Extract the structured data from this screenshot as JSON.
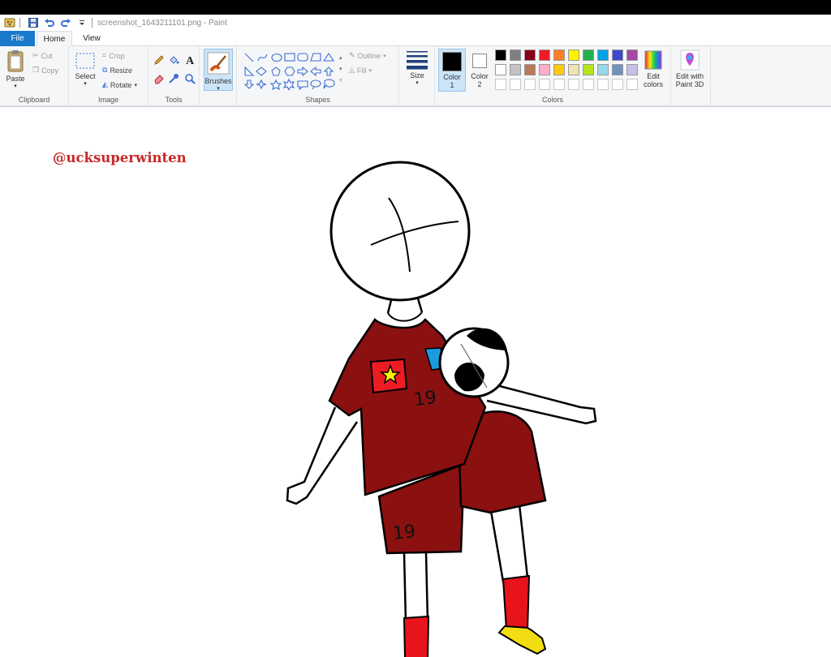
{
  "window": {
    "title": "screenshot_1643211101.png - Paint"
  },
  "tabs": {
    "file": "File",
    "home": "Home",
    "view": "View"
  },
  "clipboard": {
    "paste": "Paste",
    "cut": "Cut",
    "copy": "Copy",
    "group": "Clipboard"
  },
  "image": {
    "select": "Select",
    "crop": "Crop",
    "resize": "Resize",
    "rotate": "Rotate",
    "group": "Image"
  },
  "tools": {
    "group": "Tools"
  },
  "brushes": {
    "label": "Brushes"
  },
  "shapes": {
    "outline": "Outline",
    "fill": "Fill",
    "group": "Shapes"
  },
  "size": {
    "label": "Size"
  },
  "colors": {
    "color1_line1": "Color",
    "color1_line2": "1",
    "color2_line1": "Color",
    "color2_line2": "2",
    "color1_value": "#000000",
    "color2_value": "#ffffff",
    "edit_line1": "Edit",
    "edit_line2": "colors",
    "paint3d_line1": "Edit with",
    "paint3d_line2": "Paint 3D",
    "group": "Colors",
    "palette_row1": [
      "#000000",
      "#7f7f7f",
      "#880015",
      "#ed1c24",
      "#ff7f27",
      "#fff200",
      "#22b14c",
      "#00a2e8",
      "#3f48cc",
      "#a349a4"
    ],
    "palette_row2": [
      "#ffffff",
      "#c3c3c3",
      "#b97a57",
      "#ffaec9",
      "#ffc90e",
      "#efe4b0",
      "#b5e61d",
      "#99d9ea",
      "#7092be",
      "#c8bfe7"
    ],
    "palette_row3": [
      "#ffffff",
      "#ffffff",
      "#ffffff",
      "#ffffff",
      "#ffffff",
      "#ffffff",
      "#ffffff",
      "#ffffff",
      "#ffffff",
      "#ffffff"
    ]
  },
  "canvas": {
    "watermark": "@ucksuperwinten",
    "jersey_number": "19",
    "shorts_number": "19",
    "colors": {
      "kit": "#8b1010",
      "sock": "#e8141c",
      "boot": "#f2dc12",
      "patch": "#1a9be0"
    }
  }
}
